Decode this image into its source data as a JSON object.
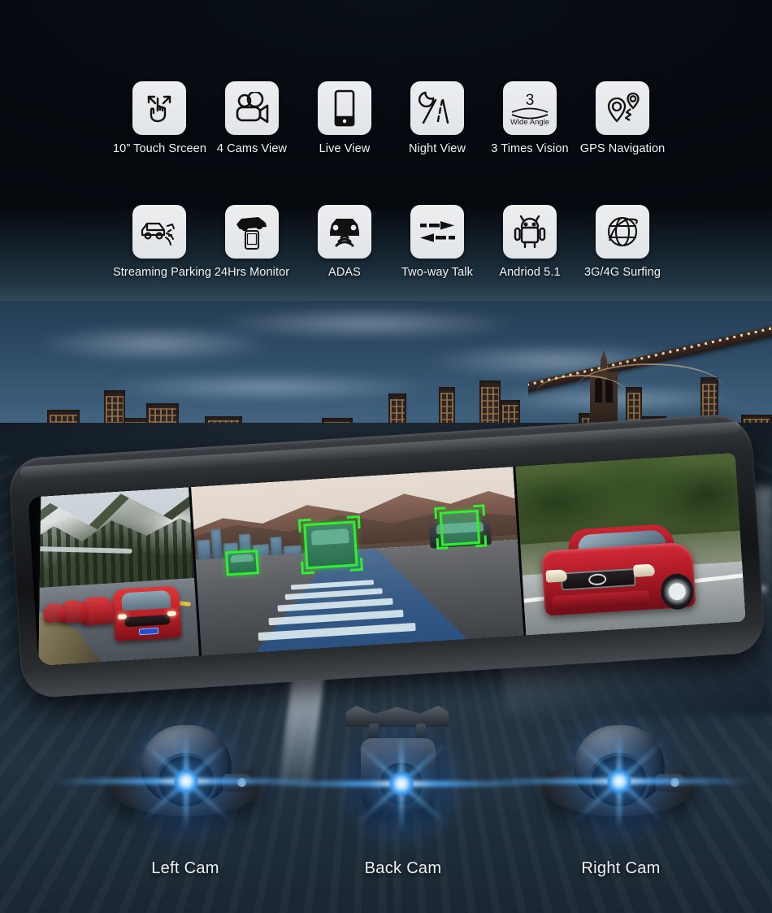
{
  "features": {
    "row1": [
      {
        "label": "10”  Touch Srceen",
        "icon": "touch-screen-icon"
      },
      {
        "label": "4 Cams View",
        "icon": "video-camera-icon"
      },
      {
        "label": "Live View",
        "icon": "smartphone-icon"
      },
      {
        "label": "Night View",
        "icon": "moon-road-icon"
      },
      {
        "label": "3 Times Vision",
        "icon": "wide-angle-icon",
        "badge_number": "3",
        "badge_caption": "Wide Angle"
      },
      {
        "label": "GPS Navigation",
        "icon": "gps-pin-icon"
      }
    ],
    "row2": [
      {
        "label": "Streaming Parking",
        "icon": "parking-radar-car-icon"
      },
      {
        "label": "24Hrs Monitor",
        "icon": "car-phone-monitor-icon"
      },
      {
        "label": "ADAS",
        "icon": "car-sensor-icon"
      },
      {
        "label": "Two-way Talk",
        "icon": "two-way-arrows-icon"
      },
      {
        "label": "Andriod 5.1",
        "icon": "android-robot-icon"
      },
      {
        "label": "3G/4G Surfing",
        "icon": "globe-network-icon"
      }
    ]
  },
  "mirror": {
    "panels": [
      {
        "name": "left-camera-feed",
        "scene": "Red SUV convoy on snowy mountain road"
      },
      {
        "name": "front-adas-feed",
        "scene": "Highway with ADAS vehicle detection boxes"
      },
      {
        "name": "right-camera-feed",
        "scene": "Red sedan driving on road"
      }
    ],
    "adas": {
      "detections": 3,
      "box_color": "#2ef02e",
      "lane_overlay_color": "#2a6ebe"
    }
  },
  "cameras": [
    {
      "label": "Left Cam",
      "type": "dome-camera"
    },
    {
      "label": "Back Cam",
      "type": "box-camera"
    },
    {
      "label": "Right Cam",
      "type": "dome-camera"
    }
  ],
  "colors": {
    "tile_background": "#eceef0",
    "icon_stroke": "#111111",
    "label_text": "#f2f5f7",
    "flare_blue": "#2f8fe8",
    "detection_green": "#2ef02e",
    "background_top": "#05080c"
  }
}
